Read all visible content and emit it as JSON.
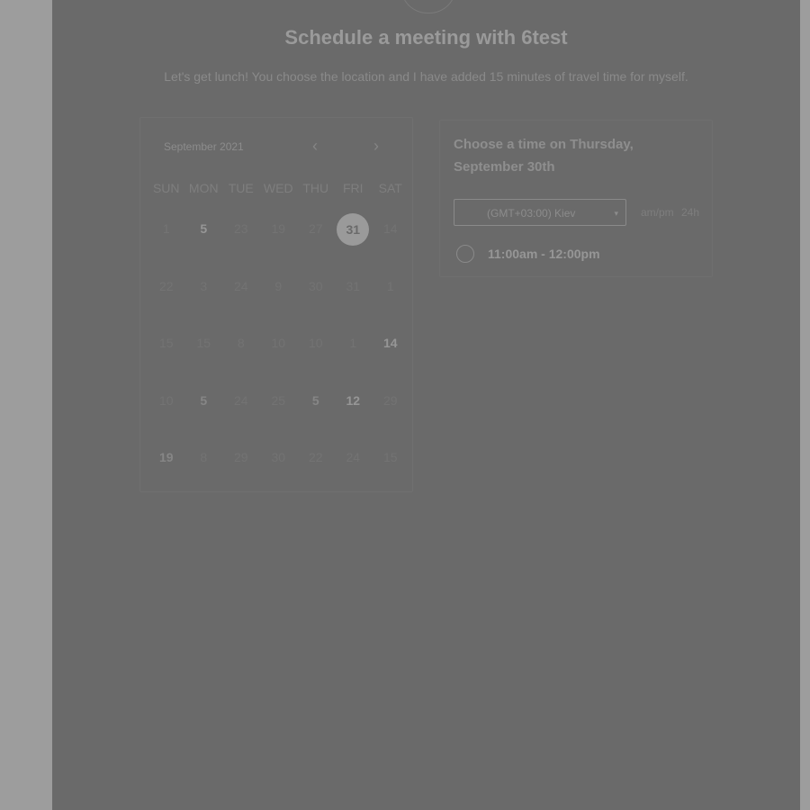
{
  "header": {
    "title": "Schedule a meeting with 6test",
    "subtitle": "Let's get lunch! You choose the location and I have added 15 minutes of travel time for myself."
  },
  "calendar": {
    "month_label": "September 2021",
    "prev_icon": "chevron-left-icon",
    "next_icon": "chevron-right-icon",
    "prev_glyph": "‹",
    "next_glyph": "›",
    "weekdays": [
      "SUN",
      "MON",
      "TUE",
      "WED",
      "THU",
      "FRI",
      "SAT"
    ],
    "days": [
      {
        "label": "1",
        "state": "muted"
      },
      {
        "label": "5",
        "state": "available"
      },
      {
        "label": "23",
        "state": "muted"
      },
      {
        "label": "19",
        "state": "muted"
      },
      {
        "label": "27",
        "state": "muted"
      },
      {
        "label": "31",
        "state": "selected"
      },
      {
        "label": "14",
        "state": "muted"
      },
      {
        "label": "22",
        "state": "muted"
      },
      {
        "label": "3",
        "state": "muted"
      },
      {
        "label": "24",
        "state": "muted"
      },
      {
        "label": "9",
        "state": "muted"
      },
      {
        "label": "30",
        "state": "muted"
      },
      {
        "label": "31",
        "state": "muted"
      },
      {
        "label": "1",
        "state": "muted"
      },
      {
        "label": "15",
        "state": "muted"
      },
      {
        "label": "15",
        "state": "muted"
      },
      {
        "label": "8",
        "state": "muted"
      },
      {
        "label": "10",
        "state": "muted"
      },
      {
        "label": "10",
        "state": "muted"
      },
      {
        "label": "1",
        "state": "muted"
      },
      {
        "label": "14",
        "state": "available"
      },
      {
        "label": "10",
        "state": "muted"
      },
      {
        "label": "5",
        "state": "available-dim"
      },
      {
        "label": "24",
        "state": "muted"
      },
      {
        "label": "25",
        "state": "muted"
      },
      {
        "label": "5",
        "state": "available-dim"
      },
      {
        "label": "12",
        "state": "available"
      },
      {
        "label": "29",
        "state": "muted"
      },
      {
        "label": "19",
        "state": "available-dim"
      },
      {
        "label": "8",
        "state": "muted"
      },
      {
        "label": "29",
        "state": "muted"
      },
      {
        "label": "30",
        "state": "muted"
      },
      {
        "label": "22",
        "state": "muted"
      },
      {
        "label": "24",
        "state": "muted"
      },
      {
        "label": "15",
        "state": "muted"
      }
    ]
  },
  "times": {
    "heading": "Choose a time on Thursday, September 30th",
    "timezone": "(GMT+03:00) Kiev",
    "timezone_caret": "▾",
    "format_ampm": "am/pm",
    "format_24h": "24h",
    "slots": [
      {
        "label": "11:00am - 12:00pm"
      }
    ]
  }
}
